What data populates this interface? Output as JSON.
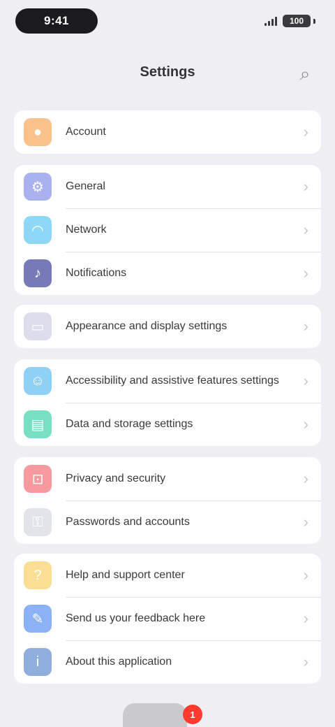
{
  "status_bar": {
    "time": "9:41",
    "battery": "100"
  },
  "nav": {
    "title": "Settings",
    "action_icon": "search-icon"
  },
  "groups": [
    {
      "items": [
        {
          "label": "Account",
          "icon": "person-icon",
          "color": "#f9c28b"
        }
      ]
    },
    {
      "items": [
        {
          "label": "General",
          "icon": "gear-icon",
          "color": "#a9b1ee"
        },
        {
          "label": "Network",
          "icon": "wifi-icon",
          "color": "#8fd7f6"
        },
        {
          "label": "Notifications",
          "icon": "bell-icon",
          "color": "#767bb8"
        }
      ]
    },
    {
      "items": [
        {
          "label": "Appearance and display settings",
          "icon": "display-icon",
          "color": "#dcdcec"
        }
      ]
    },
    {
      "items": [
        {
          "label": "Accessibility and assistive features settings",
          "icon": "accessibility-icon",
          "color": "#8fd0f6"
        },
        {
          "label": "Data and storage settings",
          "icon": "storage-icon",
          "color": "#76dfc4"
        }
      ]
    },
    {
      "items": [
        {
          "label": "Privacy and security",
          "icon": "lock-icon",
          "color": "#f79a9f"
        },
        {
          "label": "Passwords and accounts",
          "icon": "key-icon",
          "color": "#e3e3ea"
        }
      ]
    },
    {
      "items": [
        {
          "label": "Help and support center",
          "icon": "help-icon",
          "color": "#f9de93"
        },
        {
          "label": "Send us your feedback here",
          "icon": "feedback-icon",
          "color": "#8bb2f7"
        },
        {
          "label": "About this application",
          "icon": "info-icon",
          "color": "#8faedb"
        }
      ]
    }
  ],
  "tab_bar": {
    "badge": "1"
  }
}
